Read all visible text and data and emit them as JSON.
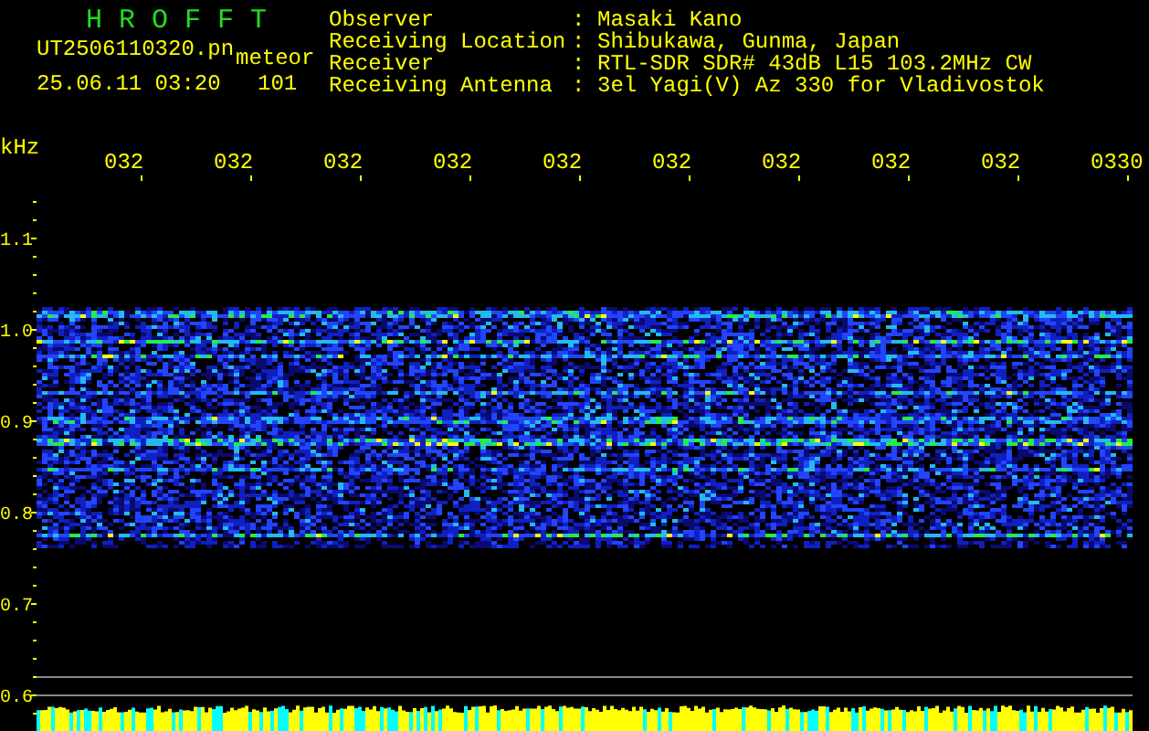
{
  "header": {
    "logo": "H R O F F T",
    "filename": "UT2506110320.pn",
    "mode": "meteor",
    "datetime": "25.06.11 03:20",
    "count": "101"
  },
  "station": [
    {
      "label": "Observer",
      "separator": ":",
      "value": "Masaki Kano"
    },
    {
      "label": "Receiving Location",
      "separator": ":",
      "value": "Shibukawa, Gunma, Japan"
    },
    {
      "label": "Receiver",
      "separator": ":",
      "value": "RTL-SDR SDR# 43dB L15 103.2MHz CW"
    },
    {
      "label": "Receiving Antenna",
      "separator": ":",
      "value": "3el Yagi(V) Az 330 for Vladivostok"
    }
  ],
  "plot": {
    "unit": "kHz",
    "time_labels": [
      "032",
      "032",
      "032",
      "032",
      "032",
      "032",
      "032",
      "032",
      "032",
      "0330"
    ],
    "freq_labels": [
      "1.1",
      "1.0",
      "0.9",
      "0.8",
      "0.7",
      "0.6"
    ]
  }
}
